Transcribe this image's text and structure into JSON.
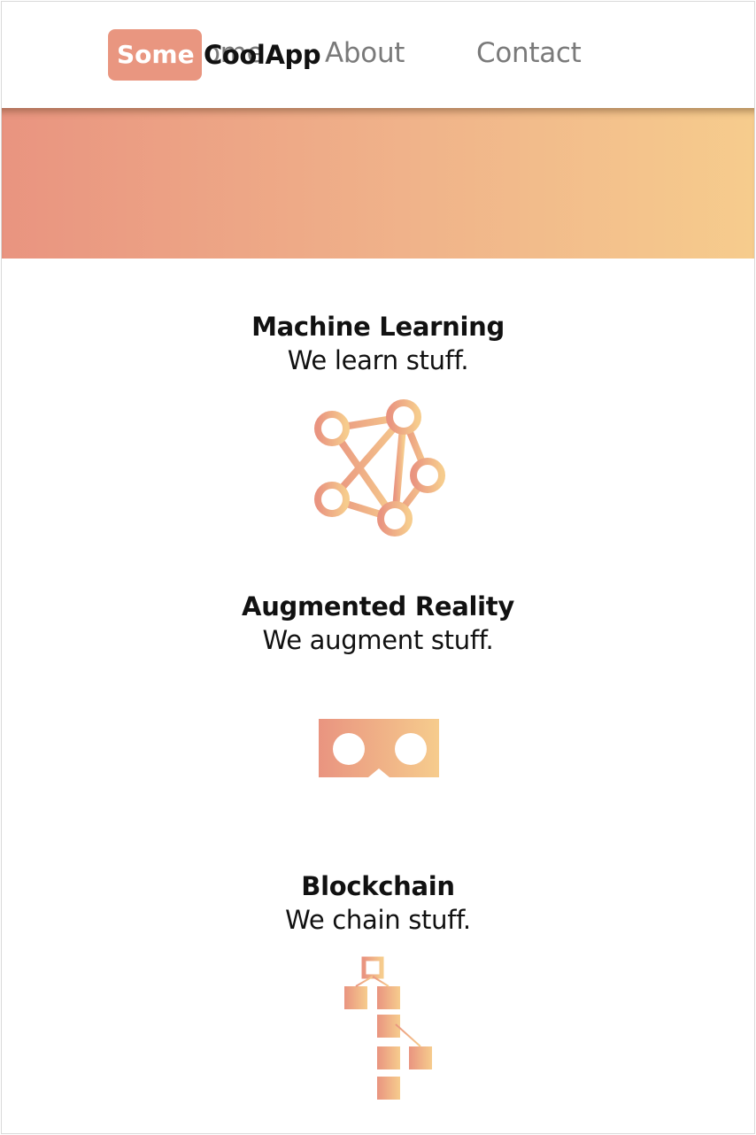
{
  "nav": {
    "logo_badge": "Some",
    "logo_text": "CoolApp",
    "links": [
      "Home",
      "About",
      "Contact"
    ]
  },
  "colors": {
    "gradient_start": "#e99480",
    "gradient_end": "#f6cc8d",
    "logo_badge": "#e99680"
  },
  "features": [
    {
      "title": "Machine Learning",
      "description": "We learn stuff.",
      "icon": "neural-network-icon"
    },
    {
      "title": "Augmented Reality",
      "description": "We augment stuff.",
      "icon": "vr-headset-icon"
    },
    {
      "title": "Blockchain",
      "description": "We chain stuff.",
      "icon": "blockchain-icon"
    }
  ]
}
